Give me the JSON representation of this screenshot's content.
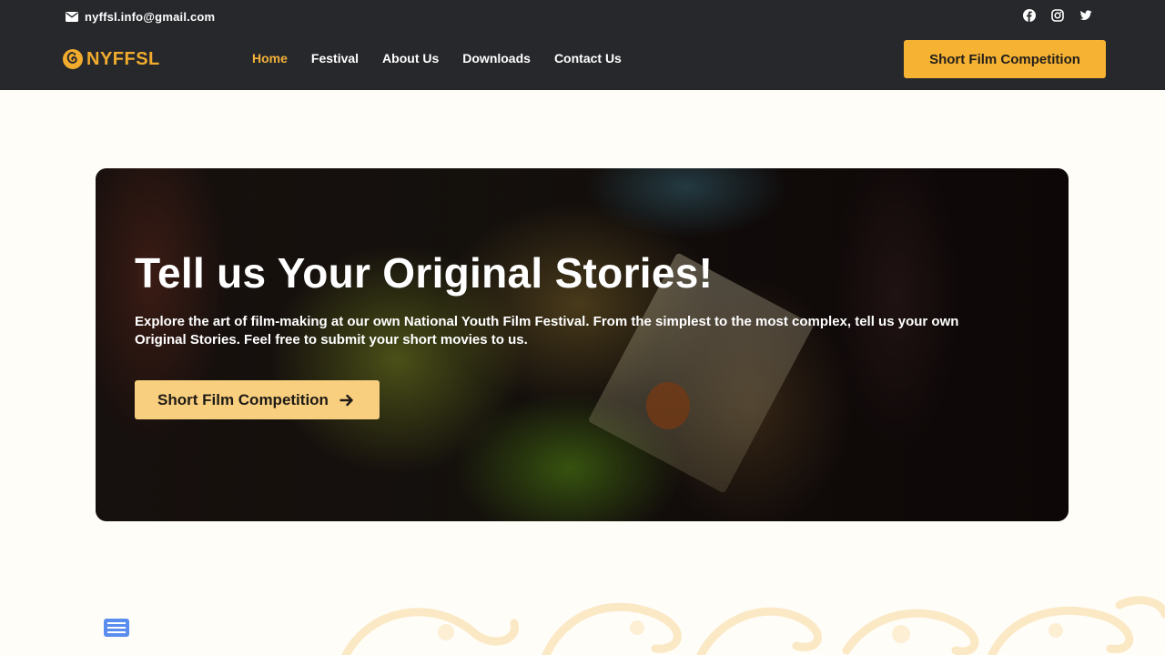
{
  "topbar": {
    "email": "nyffsl.info@gmail.com",
    "email_icon": "envelope-icon",
    "social": [
      {
        "name": "facebook",
        "icon": "facebook-icon"
      },
      {
        "name": "instagram",
        "icon": "instagram-icon"
      },
      {
        "name": "twitter",
        "icon": "twitter-icon"
      }
    ]
  },
  "logo": {
    "text": "NYFFSL"
  },
  "nav": {
    "items": [
      "Home",
      "Festival",
      "About Us",
      "Downloads",
      "Contact Us"
    ],
    "active": "Home"
  },
  "header_cta": {
    "label": "Short Film Competition"
  },
  "hero": {
    "title": "Tell us Your Original Stories!",
    "text": "Explore the art of film-making at our own National Youth Film Festival. From the simplest to the most complex, tell us your own Original Stories. Feel free to submit your short movies to us.",
    "cta_label": "Short Film Competition",
    "cta_icon": "arrow-right-icon"
  },
  "floating_icon": "newspaper-icon",
  "colors": {
    "header_bg": "#27282c",
    "accent": "#f6b233",
    "accent_light": "#f8cf7e",
    "nav_active": "#f2b13b",
    "page_bg": "#fffdf8"
  }
}
